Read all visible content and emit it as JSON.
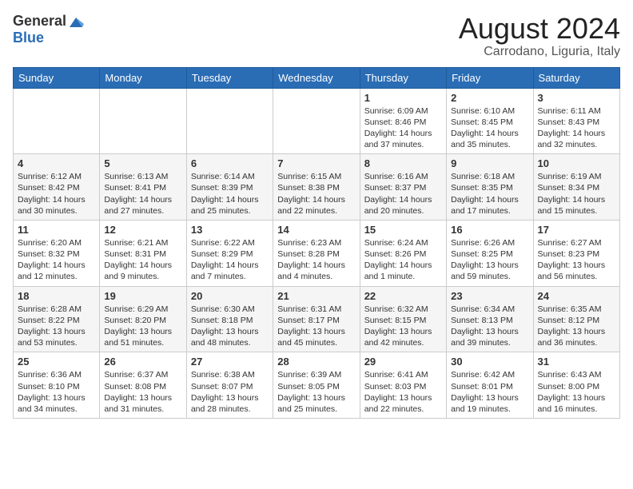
{
  "logo": {
    "general": "General",
    "blue": "Blue"
  },
  "title": {
    "month_year": "August 2024",
    "location": "Carrodano, Liguria, Italy"
  },
  "weekdays": [
    "Sunday",
    "Monday",
    "Tuesday",
    "Wednesday",
    "Thursday",
    "Friday",
    "Saturday"
  ],
  "weeks": [
    [
      {
        "num": "",
        "info": ""
      },
      {
        "num": "",
        "info": ""
      },
      {
        "num": "",
        "info": ""
      },
      {
        "num": "",
        "info": ""
      },
      {
        "num": "1",
        "info": "Sunrise: 6:09 AM\nSunset: 8:46 PM\nDaylight: 14 hours\nand 37 minutes."
      },
      {
        "num": "2",
        "info": "Sunrise: 6:10 AM\nSunset: 8:45 PM\nDaylight: 14 hours\nand 35 minutes."
      },
      {
        "num": "3",
        "info": "Sunrise: 6:11 AM\nSunset: 8:43 PM\nDaylight: 14 hours\nand 32 minutes."
      }
    ],
    [
      {
        "num": "4",
        "info": "Sunrise: 6:12 AM\nSunset: 8:42 PM\nDaylight: 14 hours\nand 30 minutes."
      },
      {
        "num": "5",
        "info": "Sunrise: 6:13 AM\nSunset: 8:41 PM\nDaylight: 14 hours\nand 27 minutes."
      },
      {
        "num": "6",
        "info": "Sunrise: 6:14 AM\nSunset: 8:39 PM\nDaylight: 14 hours\nand 25 minutes."
      },
      {
        "num": "7",
        "info": "Sunrise: 6:15 AM\nSunset: 8:38 PM\nDaylight: 14 hours\nand 22 minutes."
      },
      {
        "num": "8",
        "info": "Sunrise: 6:16 AM\nSunset: 8:37 PM\nDaylight: 14 hours\nand 20 minutes."
      },
      {
        "num": "9",
        "info": "Sunrise: 6:18 AM\nSunset: 8:35 PM\nDaylight: 14 hours\nand 17 minutes."
      },
      {
        "num": "10",
        "info": "Sunrise: 6:19 AM\nSunset: 8:34 PM\nDaylight: 14 hours\nand 15 minutes."
      }
    ],
    [
      {
        "num": "11",
        "info": "Sunrise: 6:20 AM\nSunset: 8:32 PM\nDaylight: 14 hours\nand 12 minutes."
      },
      {
        "num": "12",
        "info": "Sunrise: 6:21 AM\nSunset: 8:31 PM\nDaylight: 14 hours\nand 9 minutes."
      },
      {
        "num": "13",
        "info": "Sunrise: 6:22 AM\nSunset: 8:29 PM\nDaylight: 14 hours\nand 7 minutes."
      },
      {
        "num": "14",
        "info": "Sunrise: 6:23 AM\nSunset: 8:28 PM\nDaylight: 14 hours\nand 4 minutes."
      },
      {
        "num": "15",
        "info": "Sunrise: 6:24 AM\nSunset: 8:26 PM\nDaylight: 14 hours\nand 1 minute."
      },
      {
        "num": "16",
        "info": "Sunrise: 6:26 AM\nSunset: 8:25 PM\nDaylight: 13 hours\nand 59 minutes."
      },
      {
        "num": "17",
        "info": "Sunrise: 6:27 AM\nSunset: 8:23 PM\nDaylight: 13 hours\nand 56 minutes."
      }
    ],
    [
      {
        "num": "18",
        "info": "Sunrise: 6:28 AM\nSunset: 8:22 PM\nDaylight: 13 hours\nand 53 minutes."
      },
      {
        "num": "19",
        "info": "Sunrise: 6:29 AM\nSunset: 8:20 PM\nDaylight: 13 hours\nand 51 minutes."
      },
      {
        "num": "20",
        "info": "Sunrise: 6:30 AM\nSunset: 8:18 PM\nDaylight: 13 hours\nand 48 minutes."
      },
      {
        "num": "21",
        "info": "Sunrise: 6:31 AM\nSunset: 8:17 PM\nDaylight: 13 hours\nand 45 minutes."
      },
      {
        "num": "22",
        "info": "Sunrise: 6:32 AM\nSunset: 8:15 PM\nDaylight: 13 hours\nand 42 minutes."
      },
      {
        "num": "23",
        "info": "Sunrise: 6:34 AM\nSunset: 8:13 PM\nDaylight: 13 hours\nand 39 minutes."
      },
      {
        "num": "24",
        "info": "Sunrise: 6:35 AM\nSunset: 8:12 PM\nDaylight: 13 hours\nand 36 minutes."
      }
    ],
    [
      {
        "num": "25",
        "info": "Sunrise: 6:36 AM\nSunset: 8:10 PM\nDaylight: 13 hours\nand 34 minutes."
      },
      {
        "num": "26",
        "info": "Sunrise: 6:37 AM\nSunset: 8:08 PM\nDaylight: 13 hours\nand 31 minutes."
      },
      {
        "num": "27",
        "info": "Sunrise: 6:38 AM\nSunset: 8:07 PM\nDaylight: 13 hours\nand 28 minutes."
      },
      {
        "num": "28",
        "info": "Sunrise: 6:39 AM\nSunset: 8:05 PM\nDaylight: 13 hours\nand 25 minutes."
      },
      {
        "num": "29",
        "info": "Sunrise: 6:41 AM\nSunset: 8:03 PM\nDaylight: 13 hours\nand 22 minutes."
      },
      {
        "num": "30",
        "info": "Sunrise: 6:42 AM\nSunset: 8:01 PM\nDaylight: 13 hours\nand 19 minutes."
      },
      {
        "num": "31",
        "info": "Sunrise: 6:43 AM\nSunset: 8:00 PM\nDaylight: 13 hours\nand 16 minutes."
      }
    ]
  ]
}
